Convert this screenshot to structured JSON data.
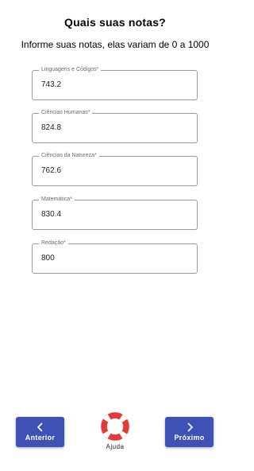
{
  "header": {
    "title": "Quais suas notas?",
    "subtitle": "Informe suas notas, elas variam de 0 a 1000"
  },
  "fields": [
    {
      "label": "Linguagens e Códigos*",
      "value": "743.2"
    },
    {
      "label": "Ciências Humanas*",
      "value": "824.8"
    },
    {
      "label": "Ciências da Natureza*",
      "value": "762.6"
    },
    {
      "label": "Matemática*",
      "value": "830.4"
    },
    {
      "label": "Redação*",
      "value": "800"
    }
  ],
  "footer": {
    "previous_label": "Anterior",
    "next_label": "Próximo",
    "help_label": "Ajuda",
    "previous_icon": "chevron-left-icon",
    "next_icon": "chevron-right-icon",
    "help_icon": "lifebuoy-icon"
  },
  "colors": {
    "primary": "#3f51b5",
    "lifebuoy_red": "#e53935",
    "field_border": "#9a9a9a"
  }
}
